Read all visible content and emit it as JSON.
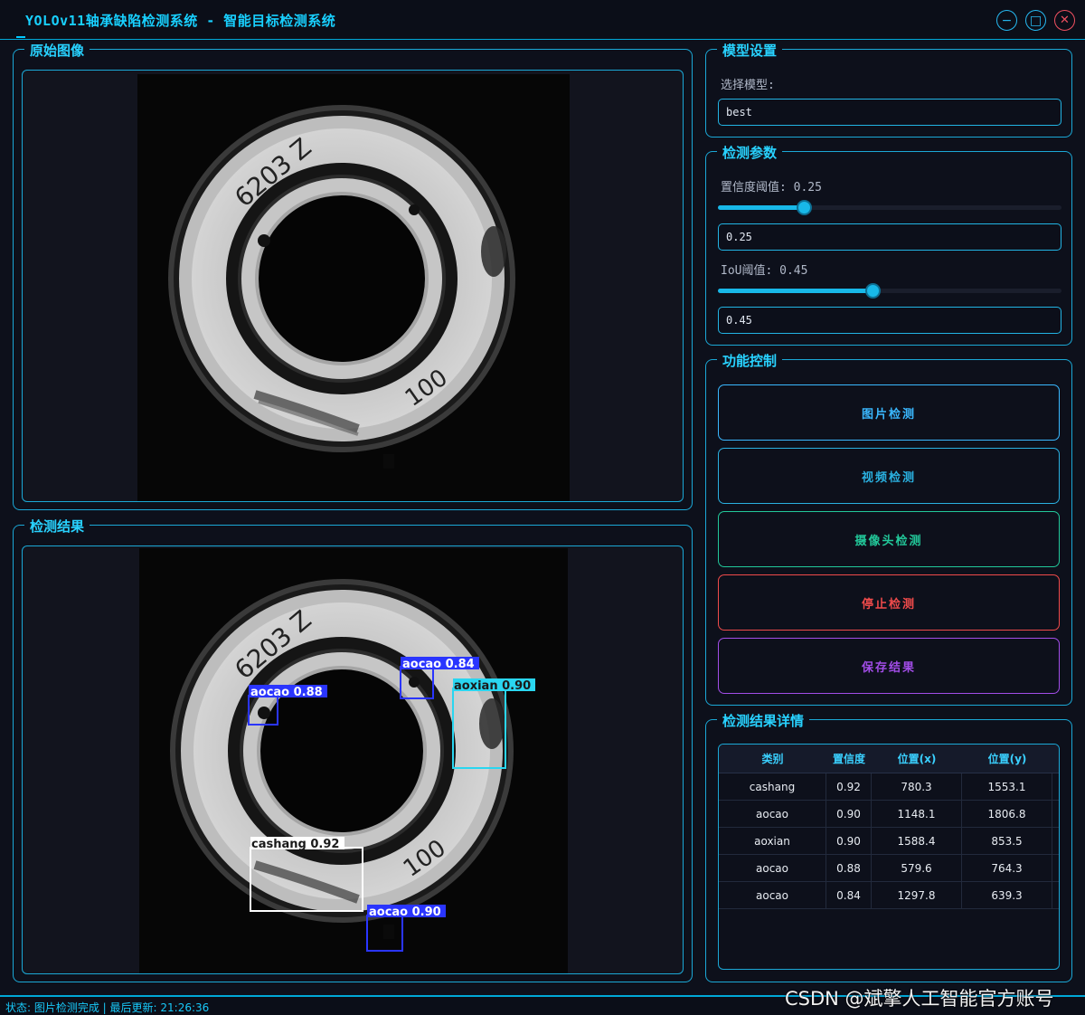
{
  "window": {
    "title": "YOLOv11轴承缺陷检测系统 - 智能目标检测系统",
    "minimize_glyph": "−",
    "maximize_glyph": "□",
    "close_glyph": "✕"
  },
  "original_panel": {
    "title": "原始图像"
  },
  "result_panel": {
    "title": "检测结果"
  },
  "bearing": {
    "text_left": "6203 Z",
    "text_right": "100"
  },
  "detections": [
    {
      "label": "aocao 0.88",
      "color": "#2a35ff"
    },
    {
      "label": "aocao 0.84",
      "color": "#2a35ff"
    },
    {
      "label": "aoxian 0.90",
      "color": "#2ad6f0"
    },
    {
      "label": "cashang 0.92",
      "color": "#ffffff"
    },
    {
      "label": "aocao 0.90",
      "color": "#2a35ff"
    }
  ],
  "model_settings": {
    "title": "模型设置",
    "select_label": "选择模型:",
    "selected_model": "best"
  },
  "detection_params": {
    "title": "检测参数",
    "confidence": {
      "label": "置信度阈值: 0.25",
      "value": 0.25,
      "input_value": "0.25"
    },
    "iou": {
      "label": "IoU阈值: 0.45",
      "value": 0.45,
      "input_value": "0.45"
    }
  },
  "function_control": {
    "title": "功能控制",
    "buttons": [
      {
        "label": "图片检测",
        "color": "#3ab8ff"
      },
      {
        "label": "视频检测",
        "color": "#2ab0e0"
      },
      {
        "label": "摄像头检测",
        "color": "#22c89a"
      },
      {
        "label": "停止检测",
        "color": "#f04b4b"
      },
      {
        "label": "保存结果",
        "color": "#a24de8"
      }
    ]
  },
  "results_detail": {
    "title": "检测结果详情",
    "columns": [
      "类别",
      "置信度",
      "位置(x)",
      "位置(y)"
    ],
    "rows": [
      [
        "cashang",
        "0.92",
        "780.3",
        "1553.1"
      ],
      [
        "aocao",
        "0.90",
        "1148.1",
        "1806.8"
      ],
      [
        "aoxian",
        "0.90",
        "1588.4",
        "853.5"
      ],
      [
        "aocao",
        "0.88",
        "579.6",
        "764.3"
      ],
      [
        "aocao",
        "0.84",
        "1297.8",
        "639.3"
      ]
    ]
  },
  "status": {
    "text": "状态: 图片检测完成 | 最后更新: 21:26:36"
  },
  "watermark": {
    "text": "CSDN @斌擎人工智能官方账号"
  }
}
